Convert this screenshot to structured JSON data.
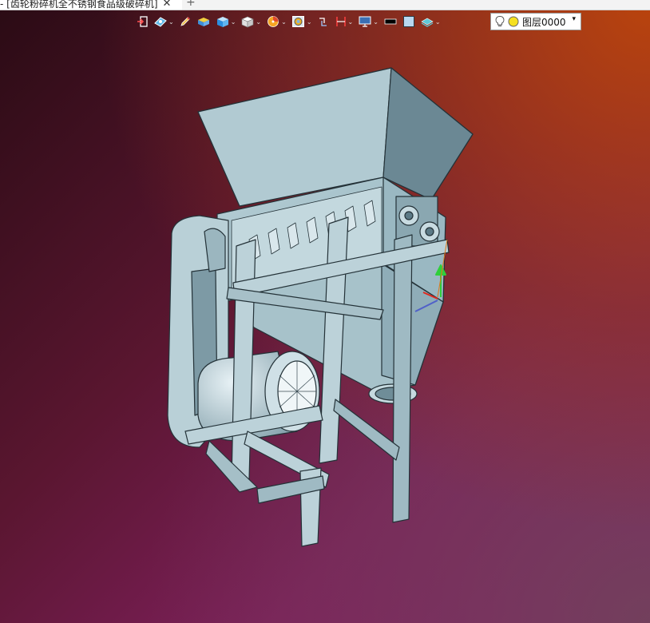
{
  "tab": {
    "title": "- [齿轮粉碎机全不锈钢食品级破碎机]",
    "close_glyph": "✕",
    "add_glyph": "+"
  },
  "toolbar": {
    "icons": [
      "exit-icon",
      "view-style-icon",
      "pencil-icon",
      "material-icon",
      "box-icon",
      "cube-view-icon",
      "render-icon",
      "lens-icon",
      "snap-icon",
      "dimension-icon",
      "monitor-icon",
      "black-rect-icon",
      "blue-square-icon",
      "layer-stack-icon"
    ]
  },
  "layer": {
    "name": "图层0000",
    "dropdown_glyph": "▾"
  },
  "colors": {
    "model_face": "#a9c3cc",
    "model_edge": "#243238",
    "accent_green": "#2fcf3a",
    "accent_red": "#e0281e",
    "accent_blue": "#5060c8",
    "accent_orange": "#e0781c"
  }
}
